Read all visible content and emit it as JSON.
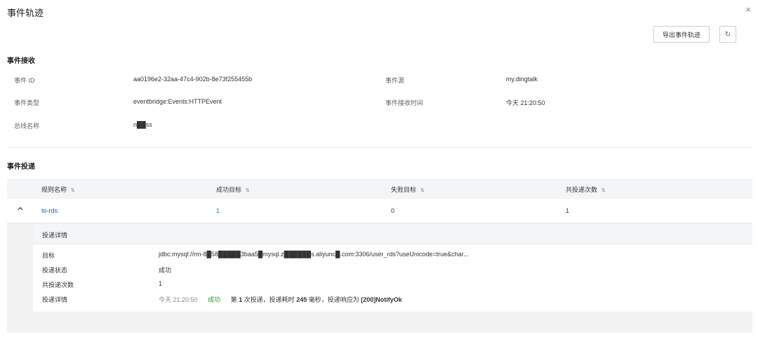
{
  "header": {
    "title": "事件轨迹",
    "close": "×"
  },
  "toolbar": {
    "export_label": "导出事件轨迹",
    "refresh": "↻"
  },
  "receive": {
    "title": "事件接收",
    "fields": {
      "event_id_label": "事件 ID",
      "event_id_value": "aa0196e2-32aa-47c4-902b-8e73f255455b",
      "source_label": "事件源",
      "source_value": "my.dingtalk",
      "type_label": "事件类型",
      "type_value": "eventbridge:Events:HTTPEvent",
      "time_label": "事件接收时间",
      "time_value": "今天 21:20:50",
      "bus_label": "总线名称",
      "bus_value": "n██ss"
    }
  },
  "delivery": {
    "title": "事件投递",
    "columns": {
      "rule": "规则名称",
      "success": "成功目标",
      "failed": "失败目标",
      "count": "共投递次数"
    },
    "sort_icon": "⇅",
    "row": {
      "rule": "to-rds",
      "success": "1",
      "failed": "0",
      "count": "1"
    },
    "detail": {
      "title": "投递详情",
      "target_label": "目标",
      "target_value": "jdbc:mysql://rm-8█58█████3baa5█mysql.z██████s.aliyunc█.com:3306/user_rds?useUnicode=true&char...",
      "status_label": "投递状态",
      "status_value": "成功",
      "count_label": "共投递次数",
      "count_value": "1",
      "info_label": "投递详情",
      "info_time": "今天 21:20:50",
      "info_status": "成功",
      "info_text_prefix": "第",
      "info_nth": "1",
      "info_text_mid": "次投递，投递耗时",
      "info_ms": "245",
      "info_text_ms": "毫秒，投递响应为",
      "info_response": "[200]NotifyOk"
    }
  }
}
